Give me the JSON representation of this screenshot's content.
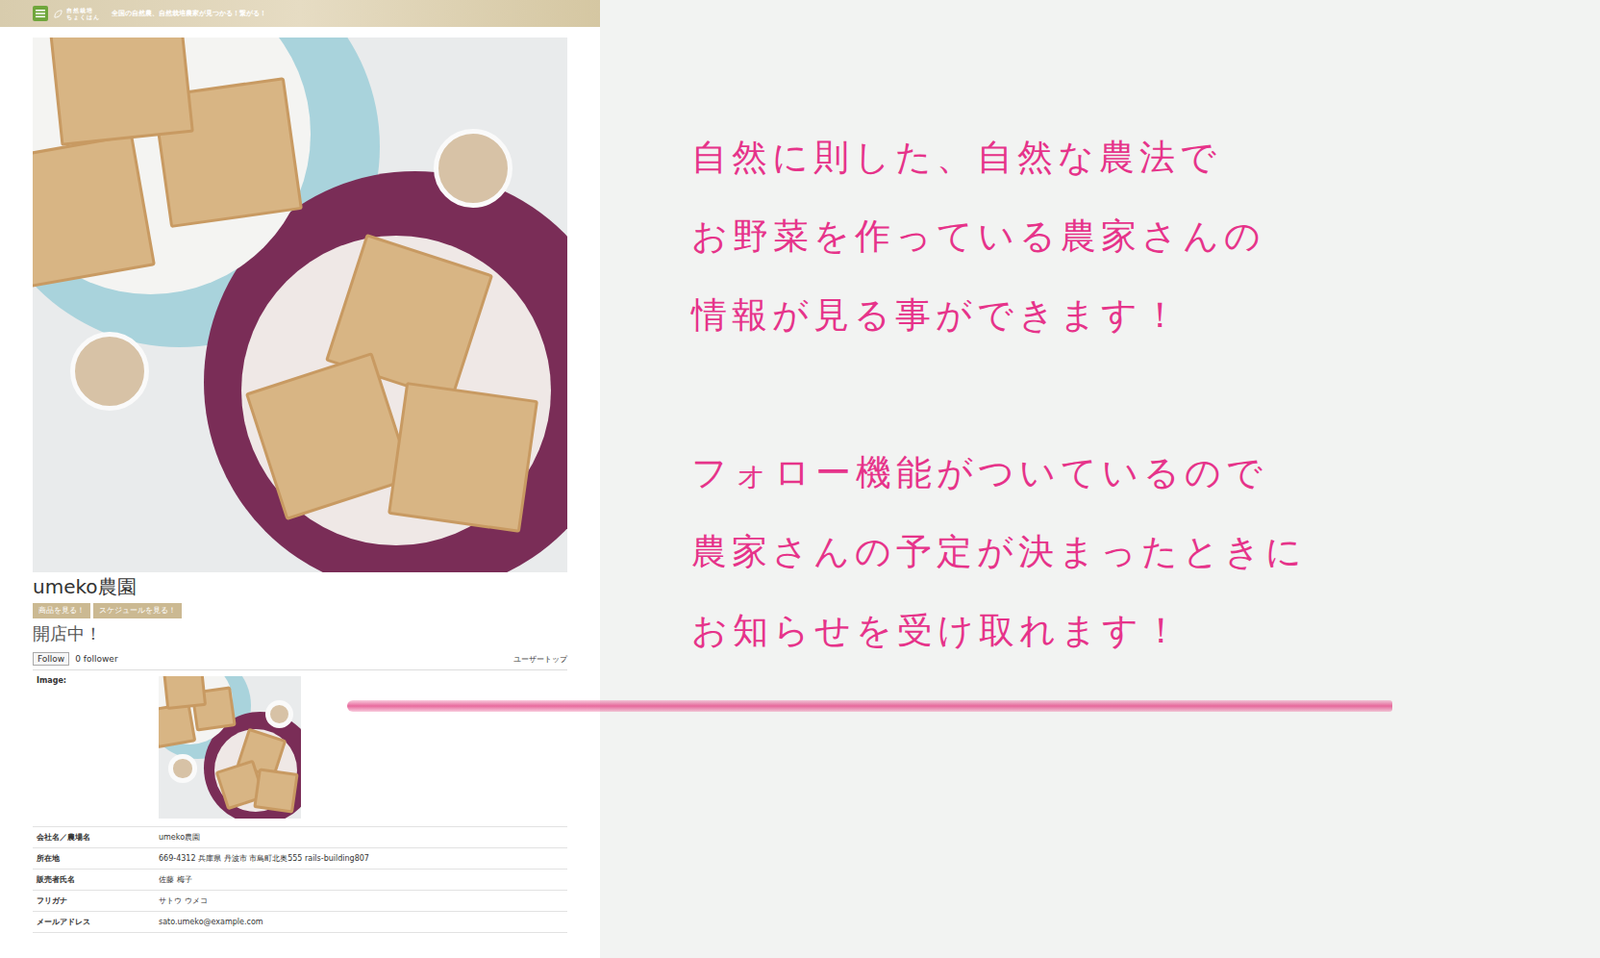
{
  "site": {
    "logo": [
      "自然栽培",
      "ちょくはん"
    ],
    "tagline": "全国の自然農、自然栽培農家が見つかる！繋がる！"
  },
  "farm": {
    "name": "umeko農園",
    "buttons": [
      "商品を見る！",
      "スケジュールを見る！"
    ],
    "status": "開店中！"
  },
  "follow": {
    "button": "Follow",
    "count": "0 follower",
    "link": "ユーザートップ"
  },
  "details": {
    "image_label": "Image:",
    "rows": [
      {
        "label": "会社名／農場名",
        "value": "umeko農園"
      },
      {
        "label": "所在地",
        "value": "669-4312 兵庫県 丹波市 市島町北奥555 rails-building807"
      },
      {
        "label": "販売者氏名",
        "value": "佐藤 梅子"
      },
      {
        "label": "フリガナ",
        "value": "サトウ ウメコ"
      },
      {
        "label": "メールアドレス",
        "value": "sato.umeko@example.com"
      }
    ]
  },
  "notes": {
    "paragraphs": [
      [
        "自然に則した、自然な農法で",
        "お野菜を作っている農家さんの",
        "情報が見る事ができます！"
      ],
      [
        "フォロー機能がついているので",
        "農家さんの予定が決まったときに",
        "お知らせを受け取れます！"
      ]
    ]
  }
}
